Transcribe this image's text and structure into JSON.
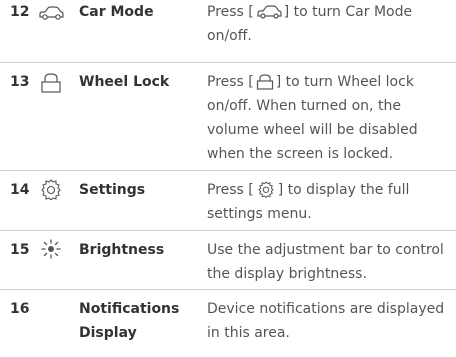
{
  "rows": [
    {
      "num": "12",
      "icon": "car-icon",
      "name": "Car Mode",
      "desc_before": "Press [",
      "desc_after": "] to turn Car Mode on/off."
    },
    {
      "num": "13",
      "icon": "lock-icon",
      "name": "Wheel Lock",
      "desc_before": "Press [",
      "desc_after": "] to turn Wheel lock on/off. When turned on, the volume wheel will be disabled when the screen is locked."
    },
    {
      "num": "14",
      "icon": "gear-icon",
      "name": "Settings",
      "desc_before": "Press [",
      "desc_after": "] to display the full settings menu."
    },
    {
      "num": "15",
      "icon": "sun-icon",
      "name": "Brightness",
      "desc": "Use the adjustment bar to control the display brightness."
    },
    {
      "num": "16",
      "name": "Notifications Display",
      "desc": "Device notifications are displayed in this area."
    }
  ],
  "colors": {
    "divider": "#cfcfcf",
    "text": "#555555",
    "heading": "#333333"
  }
}
